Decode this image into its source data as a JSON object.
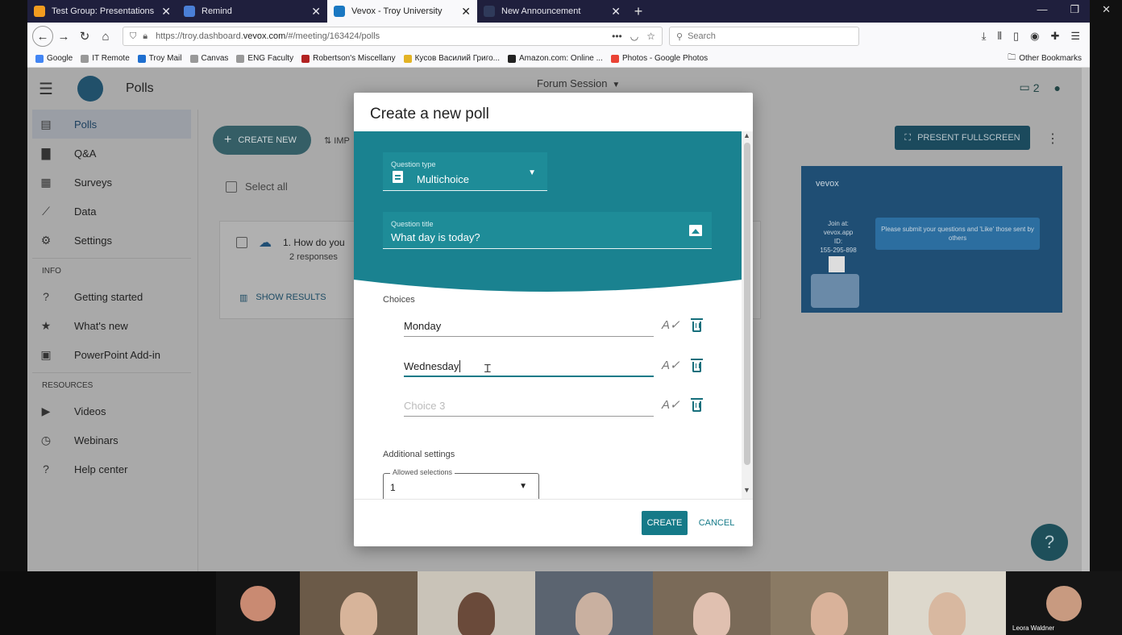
{
  "browser": {
    "tabs": [
      {
        "label": "Test Group: Presentations on G",
        "favicon_color": "#f29c1f",
        "active": false
      },
      {
        "label": "Remind",
        "favicon_color": "#4a7fd6",
        "active": false
      },
      {
        "label": "Vevox - Troy University",
        "favicon_color": "#1a78c2",
        "active": true
      },
      {
        "label": "New Announcement",
        "favicon_color": "#2f3a5a",
        "active": false
      }
    ],
    "url_prefix": "https://troy.dashboard.",
    "url_domain": "vevox.com",
    "url_suffix": "/#/meeting/163424/polls",
    "search_placeholder": "Search",
    "bookmarks": [
      {
        "label": "Google",
        "color": "#4285f4"
      },
      {
        "label": "IT Remote",
        "color": "#999999"
      },
      {
        "label": "Troy Mail",
        "color": "#1f6fd0"
      },
      {
        "label": "Canvas",
        "color": "#999999"
      },
      {
        "label": "ENG Faculty",
        "color": "#999999"
      },
      {
        "label": "Robertson's Miscellany",
        "color": "#b22222"
      },
      {
        "label": "Кусов Василий Григо...",
        "color": "#e3b325"
      },
      {
        "label": "Amazon.com: Online ...",
        "color": "#222222"
      },
      {
        "label": "Photos - Google Photos",
        "color": "#ea4335"
      }
    ],
    "other_bookmarks": "Other Bookmarks"
  },
  "app": {
    "title": "Polls",
    "session_name": "Forum Session",
    "device_count": "2",
    "sidebar": {
      "main": [
        {
          "label": "Polls",
          "icon": "poll-icon",
          "glyph": "▤",
          "active": true
        },
        {
          "label": "Q&A",
          "icon": "chat-icon",
          "glyph": "▇"
        },
        {
          "label": "Surveys",
          "icon": "clipboard-icon",
          "glyph": "▦"
        },
        {
          "label": "Data",
          "icon": "chart-line-icon",
          "glyph": "⟋"
        },
        {
          "label": "Settings",
          "icon": "gear-icon",
          "glyph": "⚙"
        }
      ],
      "info_label": "INFO",
      "info": [
        {
          "label": "Getting started",
          "icon": "help-circle-icon",
          "glyph": "?"
        },
        {
          "label": "What's new",
          "icon": "star-icon",
          "glyph": "★"
        },
        {
          "label": "PowerPoint Add-in",
          "icon": "powerpoint-icon",
          "glyph": "▣"
        }
      ],
      "resources_label": "RESOURCES",
      "resources": [
        {
          "label": "Videos",
          "icon": "video-icon",
          "glyph": "▶"
        },
        {
          "label": "Webinars",
          "icon": "clock-icon",
          "glyph": "◷"
        },
        {
          "label": "Help center",
          "icon": "help-circle-icon",
          "glyph": "?"
        }
      ]
    },
    "create_new": "CREATE NEW",
    "import_label": "IMP",
    "select_all": "Select all",
    "poll_item": {
      "title": "1. How do you",
      "responses": "2 responses",
      "show_results": "SHOW RESULTS"
    },
    "present_fullscreen": "PRESENT FULLSCREEN",
    "preview": {
      "logo": "vevox",
      "join_line1": "Join at:",
      "join_line2": "vevox.app",
      "id_label": "ID:",
      "id_value": "155-295-898",
      "message": "Please submit your questions and 'Like' those sent by others"
    }
  },
  "modal": {
    "title": "Create a new poll",
    "question_type_label": "Question type",
    "question_type_value": "Multichoice",
    "question_title_label": "Question title",
    "question_title_value": "What day is today?",
    "choices_label": "Choices",
    "choices": [
      {
        "value": "Monday",
        "placeholder": ""
      },
      {
        "value": "Wednesday",
        "placeholder": ""
      },
      {
        "value": "",
        "placeholder": "Choice 3"
      }
    ],
    "additional_settings": "Additional settings",
    "allowed_selections_label": "Allowed selections",
    "allowed_selections_value": "1",
    "create_button": "CREATE",
    "cancel_button": "CANCEL",
    "accent_color": "#157a88",
    "header_color": "#1a8290"
  },
  "video_participants": [
    {
      "name": ""
    },
    {
      "name": ""
    },
    {
      "name": ""
    },
    {
      "name": ""
    },
    {
      "name": ""
    },
    {
      "name": ""
    },
    {
      "name": ""
    },
    {
      "name": "Leora Waldner"
    }
  ]
}
